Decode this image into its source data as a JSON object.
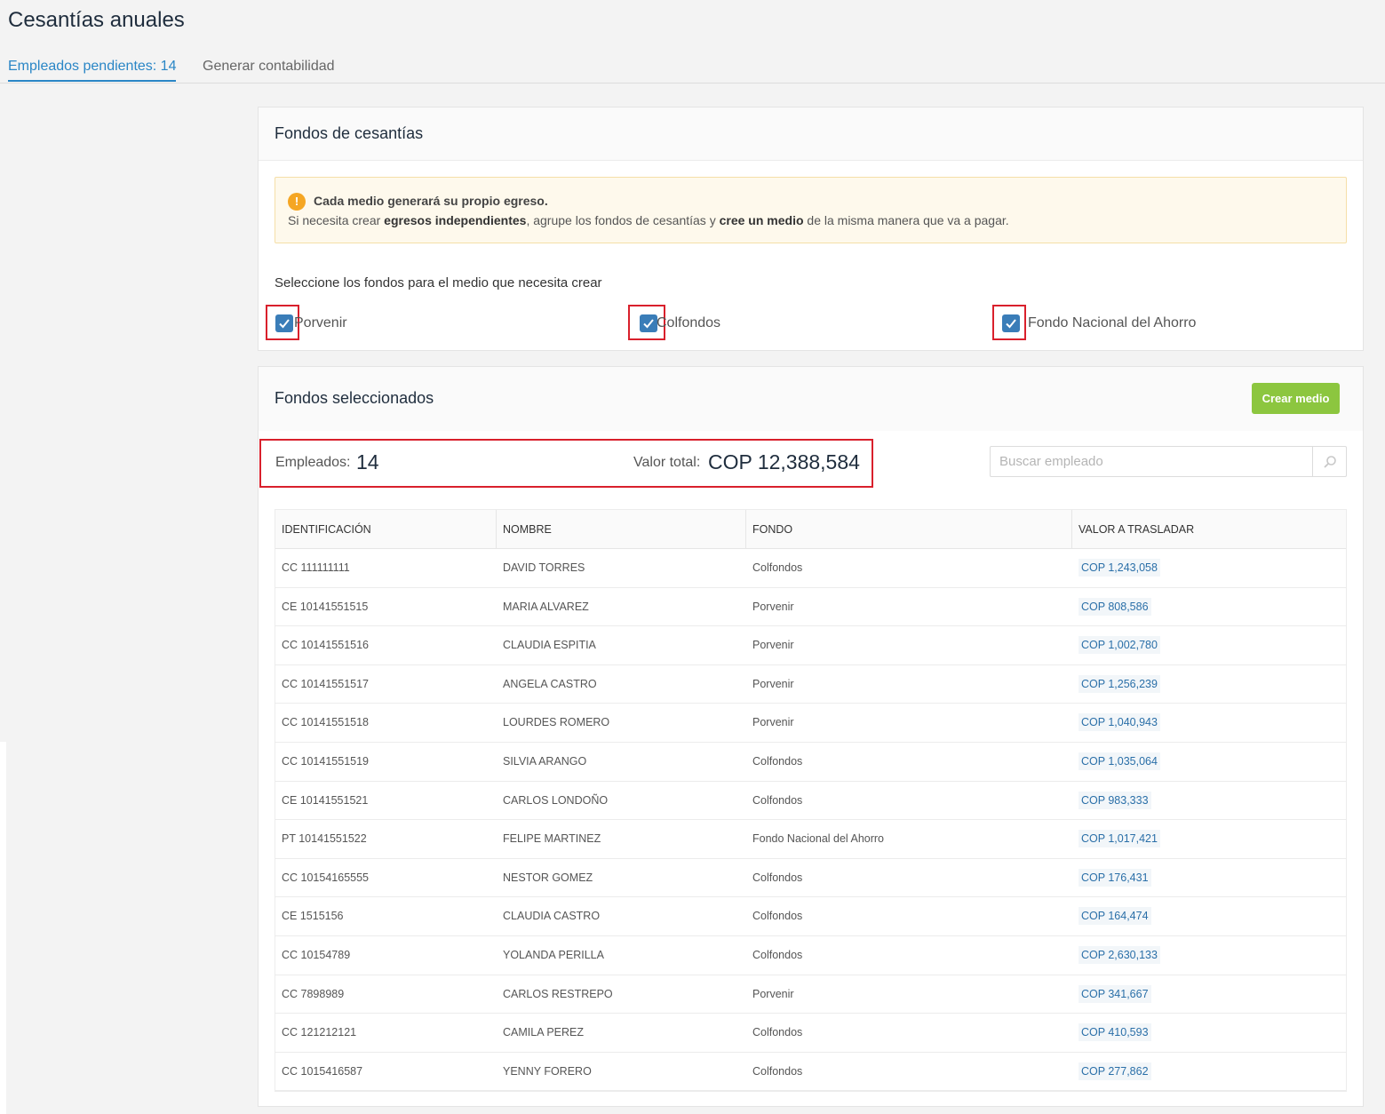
{
  "page": {
    "title": "Cesantías anuales"
  },
  "tabs": [
    {
      "label": "Empleados pendientes: 14",
      "active": true
    },
    {
      "label": "Generar contabilidad",
      "active": false
    }
  ],
  "funds_card": {
    "title": "Fondos de cesantías",
    "alert": {
      "icon": "info-icon",
      "icon_glyph": "!",
      "title": "Cada medio generará su propio egreso.",
      "text_1": "Si necesita crear ",
      "text_bold_1": "egresos independientes",
      "text_2": ", agrupe los fondos de cesantías y ",
      "text_bold_2": "cree un medio",
      "text_3": " de la misma manera que va a pagar."
    },
    "select_label": "Seleccione los fondos para el medio que necesita crear",
    "funds": [
      {
        "label": "Porvenir",
        "checked": true
      },
      {
        "label": "Colfondos",
        "checked": true
      },
      {
        "label": "Fondo Nacional del Ahorro",
        "checked": true
      }
    ]
  },
  "selected_card": {
    "title": "Fondos seleccionados",
    "create_button": "Crear medio",
    "employees_label": "Empleados:",
    "employees_value": "14",
    "total_label": "Valor total:",
    "total_value": "COP 12,388,584",
    "search_placeholder": "Buscar empleado",
    "table": {
      "headers": [
        "IDENTIFICACIÓN",
        "NOMBRE",
        "FONDO",
        "VALOR A TRASLADAR"
      ],
      "rows": [
        [
          "CC 111111111",
          "DAVID TORRES",
          "Colfondos",
          "COP 1,243,058"
        ],
        [
          "CE 10141551515",
          "MARIA ALVAREZ",
          "Porvenir",
          "COP 808,586"
        ],
        [
          "CC 10141551516",
          "CLAUDIA ESPITIA",
          "Porvenir",
          "COP 1,002,780"
        ],
        [
          "CC 10141551517",
          "ANGELA CASTRO",
          "Porvenir",
          "COP 1,256,239"
        ],
        [
          "CC 10141551518",
          "LOURDES ROMERO",
          "Porvenir",
          "COP 1,040,943"
        ],
        [
          "CC 10141551519",
          "SILVIA ARANGO",
          "Colfondos",
          "COP 1,035,064"
        ],
        [
          "CE 10141551521",
          "CARLOS LONDOÑO",
          "Colfondos",
          "COP 983,333"
        ],
        [
          "PT 10141551522",
          "FELIPE MARTINEZ",
          "Fondo Nacional del Ahorro",
          "COP 1,017,421"
        ],
        [
          "CC 10154165555",
          "NESTOR GOMEZ",
          "Colfondos",
          "COP 176,431"
        ],
        [
          "CE 1515156",
          "CLAUDIA CASTRO",
          "Colfondos",
          "COP 164,474"
        ],
        [
          "CC 10154789",
          "YOLANDA PERILLA",
          "Colfondos",
          "COP 2,630,133"
        ],
        [
          "CC 7898989",
          "CARLOS RESTREPO",
          "Porvenir",
          "COP 341,667"
        ],
        [
          "CC 121212121",
          "CAMILA PEREZ",
          "Colfondos",
          "COP 410,593"
        ],
        [
          "CC 1015416587",
          "YENNY FORERO",
          "Colfondos",
          "COP 277,862"
        ]
      ]
    }
  },
  "colors": {
    "accent": "#2a86c6",
    "checkbox": "#3a7db8",
    "create_button": "#8cc63f",
    "highlight_border": "#d9202c",
    "alert_bg": "#fef9ec",
    "alert_icon": "#f5a623"
  }
}
